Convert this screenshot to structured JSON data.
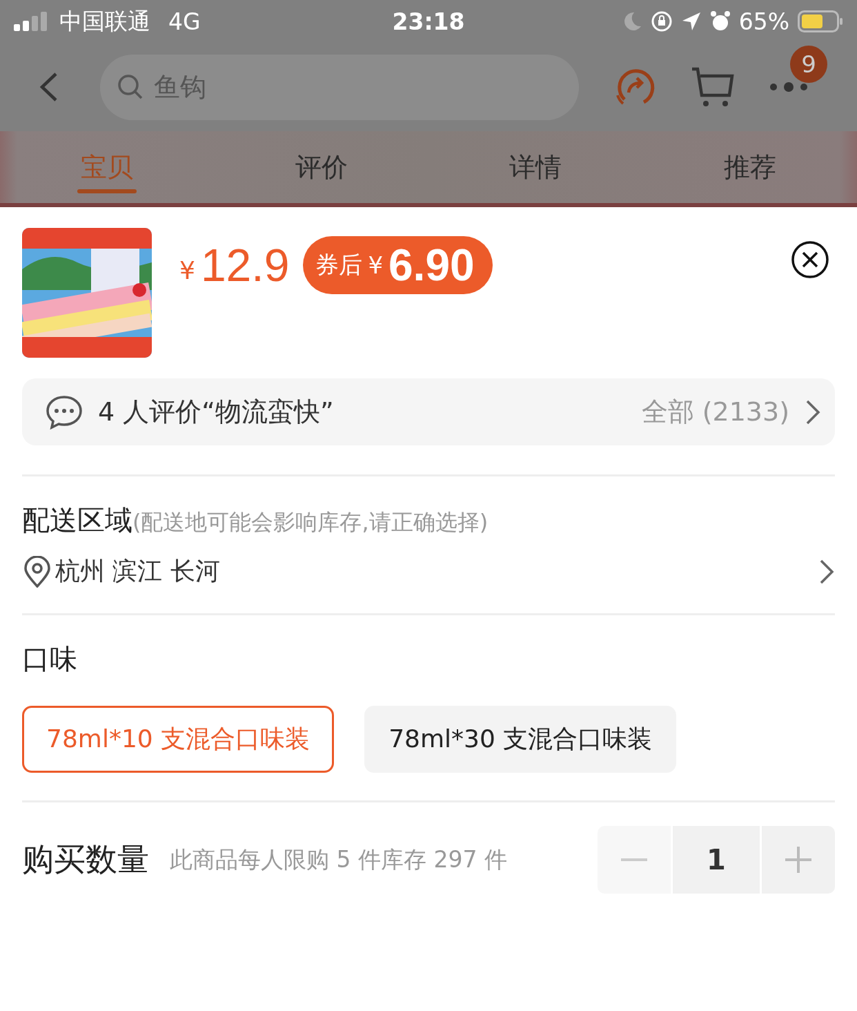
{
  "status_bar": {
    "carrier": "中国联通",
    "network": "4G",
    "time": "23:18",
    "battery": "65%"
  },
  "nav": {
    "search": {
      "placeholder": "鱼钩"
    },
    "badge": "9"
  },
  "tabs": [
    {
      "label": "宝贝",
      "selected": true
    },
    {
      "label": "评价",
      "selected": false
    },
    {
      "label": "详情",
      "selected": false
    },
    {
      "label": "推荐",
      "selected": false
    }
  ],
  "product": {
    "currency": "¥",
    "price": "12.9",
    "coupon_label": "券后",
    "coupon_currency": "¥",
    "coupon_price": "6.90"
  },
  "review_bar": {
    "summary": "4 人评价“物流蛮快”",
    "all": "全部 (2133)"
  },
  "delivery": {
    "title": "配送区域",
    "note": "(配送地可能会影响库存,请正确选择)",
    "location": "杭州 滨江 长河"
  },
  "flavor": {
    "title": "口味",
    "options": [
      {
        "label": "78ml*10 支混合口味装",
        "selected": true
      },
      {
        "label": "78ml*30 支混合口味装",
        "selected": false
      }
    ]
  },
  "quantity": {
    "title": "购买数量",
    "note": "此商品每人限购 5 件库存 297 件",
    "value": "1",
    "minus_disabled": true,
    "plus_disabled": false
  }
}
